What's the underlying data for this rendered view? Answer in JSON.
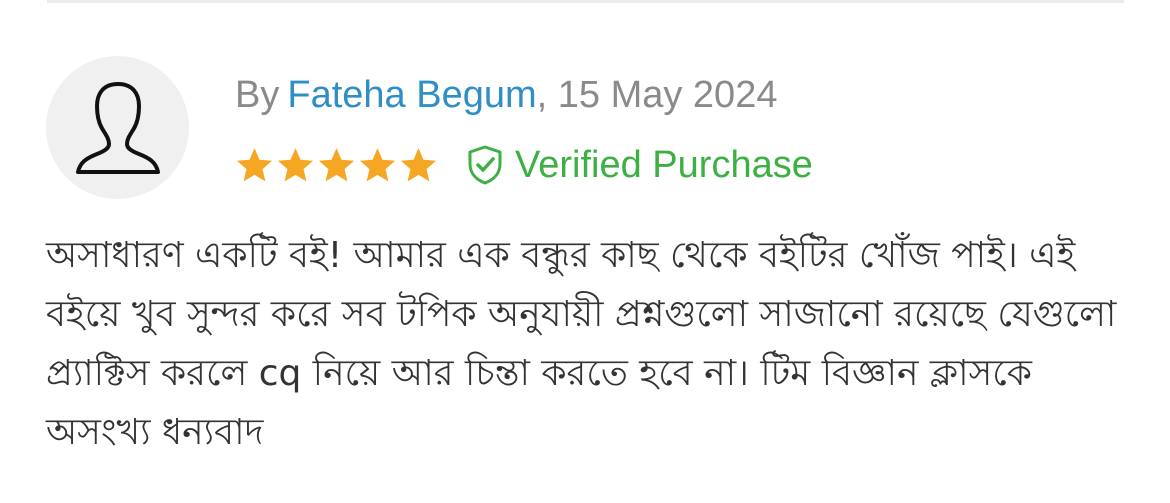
{
  "review": {
    "by_label": "By",
    "author": "Fateha Begum",
    "date_separator": ",",
    "date": "15 May 2024",
    "rating": 5,
    "rating_max": 5,
    "star_color": "#f5a623",
    "verified_icon": "shield-check-icon",
    "verified_label": "Verified Purchase",
    "verified_color": "#3cb043",
    "author_color": "#2f8fc4",
    "avatar_icon": "user-silhouette-icon",
    "text": "অসাধারণ একটি বই! আমার এক বন্ধুর কাছ থেকে বইটির খোঁজ পাই। এই বইয়ে খুব সুন্দর করে সব টপিক অনুযায়ী প্রশ্নগুলো সাজানো রয়েছে যেগুলো প্র্যাক্টিস করলে cq নিয়ে আর চিন্তা করতে হবে না। টিম বিজ্ঞান ক্লাসকে অসংখ্য ধন্যবাদ"
  }
}
